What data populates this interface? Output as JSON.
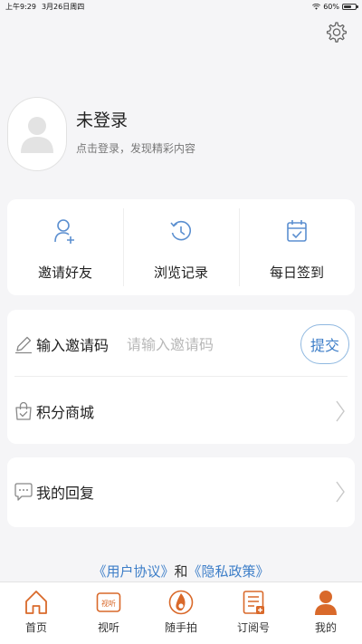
{
  "status_bar": {
    "time": "上午9:29",
    "date": "3月26日周四",
    "battery": "60%"
  },
  "profile": {
    "name": "未登录",
    "subtitle": "点击登录，发现精彩内容"
  },
  "quick_actions": [
    {
      "label": "邀请好友",
      "icon": "add-user-icon"
    },
    {
      "label": "浏览记录",
      "icon": "history-icon"
    },
    {
      "label": "每日签到",
      "icon": "calendar-check-icon"
    }
  ],
  "invite": {
    "label": "输入邀请码",
    "placeholder": "请输入邀请码",
    "submit_label": "提交"
  },
  "menu": {
    "mall_label": "积分商城",
    "reply_label": "我的回复"
  },
  "agreement": {
    "user_agreement": "《用户协议》",
    "and": "和",
    "privacy_policy": "《隐私政策》"
  },
  "tabs": [
    {
      "label": "首页",
      "icon": "home-icon"
    },
    {
      "label": "视听",
      "icon": "video-icon",
      "icon_text": "视听"
    },
    {
      "label": "随手拍",
      "icon": "snapshot-icon"
    },
    {
      "label": "订阅号",
      "icon": "subscription-icon"
    },
    {
      "label": "我的",
      "icon": "profile-icon"
    }
  ],
  "colors": {
    "accent_orange": "#d9692a",
    "link_blue": "#3d7ec8",
    "icon_blue": "#5b8fd0"
  }
}
